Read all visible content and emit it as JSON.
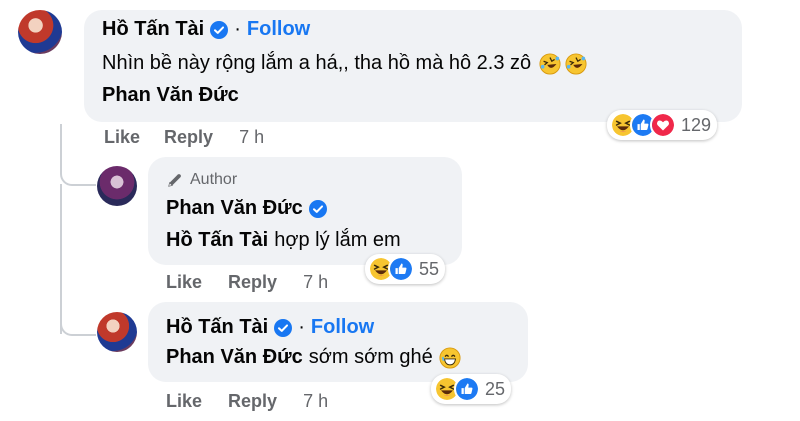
{
  "colors": {
    "accent": "#1877f2",
    "bubble": "#f0f2f5",
    "meta": "#65676b"
  },
  "comments": [
    {
      "author": "Hồ Tấn Tài",
      "follow": "Follow",
      "line1": "Nhìn bề này rộng lắm a há,, tha hồ mà hô 2.3 zô",
      "tag": "Phan Văn Đức",
      "like": "Like",
      "reply": "Reply",
      "time": "7 h",
      "reaction_count": "129",
      "reactions": [
        "haha-icon",
        "like-icon",
        "love-icon"
      ]
    },
    {
      "badge": "Author",
      "author": "Phan Văn Đức",
      "tag": "Hồ Tấn Tài",
      "text": "hợp lý lắm em",
      "like": "Like",
      "reply": "Reply",
      "time": "7 h",
      "reaction_count": "55",
      "reactions": [
        "haha-icon",
        "like-icon"
      ]
    },
    {
      "author": "Hồ Tấn Tài",
      "follow": "Follow",
      "tag": "Phan Văn Đức",
      "text": "sớm sớm ghé",
      "like": "Like",
      "reply": "Reply",
      "time": "7 h",
      "reaction_count": "25",
      "reactions": [
        "haha-icon",
        "like-icon"
      ]
    }
  ]
}
